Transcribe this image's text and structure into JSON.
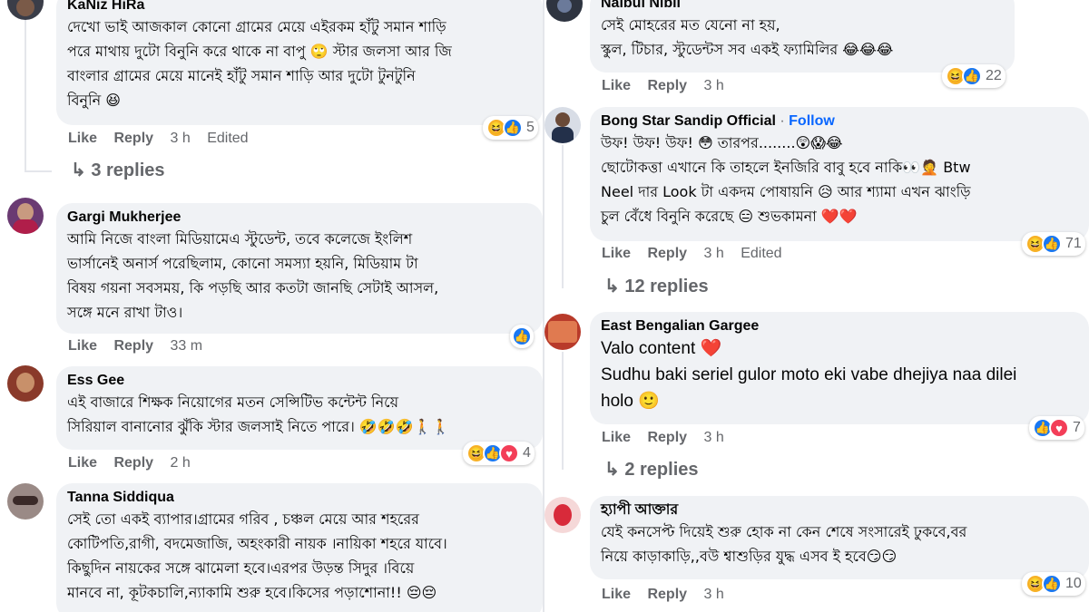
{
  "colors": {
    "accent": "#0866ff",
    "bubble": "#f0f2f5",
    "meta": "#65676b",
    "haha": "#f7b125",
    "like": "#1877f2",
    "love": "#f33e58"
  },
  "left": {
    "comments": [
      {
        "author": "KaNiz HiRa",
        "lines": [
          "দেখো ভাই আজকাল কোনো গ্রামের মেয়ে এইরকম হাঁটু সমান শাড়ি",
          "পরে মাথায় দুটো বিনুনি করে থাকে না বাপু 🙄 স্টার জলসা আর জি",
          "বাংলার গ্রামের মেয়ে মানেই হাঁটু সমান শাড়ি আর দুটো টুনটুনি",
          "বিনুনি 😆"
        ],
        "like": "Like",
        "reply": "Reply",
        "time": "3 h",
        "edited": "Edited",
        "reaction_count": "5",
        "replies": "3 replies"
      },
      {
        "author": "Gargi Mukherjee",
        "lines": [
          "আমি নিজে বাংলা মিডিয়ামেএ স্টুডেন্ট, তবে কলেজে ইংলিশ",
          "ভার্সানেই অনার্স পরেছিলাম, কোনো সমস্যা হয়নি, মিডিয়াম টা",
          "বিষয় গয়না সবসময়, কি পড়ছি আর কতটা জানছি সেটাই আসল,",
          "সঙ্গে মনে রাখা টাও।"
        ],
        "like": "Like",
        "reply": "Reply",
        "time": "33 m"
      },
      {
        "author": "Ess Gee",
        "lines": [
          "এই বাজারে শিক্ষক নিয়োগের মতন সেন্সিটিভ কন্টেন্ট নিয়ে",
          "সিরিয়াল বানানোর ঝুঁকি স্টার জলসাই নিতে পারে। 🤣🤣🤣🚶🚶"
        ],
        "like": "Like",
        "reply": "Reply",
        "time": "2 h",
        "reaction_count": "4"
      },
      {
        "author": "Tanna Siddiqua",
        "lines": [
          "সেই তো একই ব্যাপার।গ্রামের গরিব , চঞ্চল মেয়ে আর শহরের",
          "কোটিপতি,রাগী, বদমেজাজি, অহংকারী নায়ক ।নায়িকা শহরে যাবে।",
          "কিছুদিন নায়কের সঙ্গে ঝামেলা হবে।এরপর উড়ন্ত সিদুর ।বিয়ে",
          "মানবে না, কূটকচালি,ন্যাকামি শুরু হবে।কিসের পড়াশোনা!! 😔😔"
        ]
      }
    ]
  },
  "right": {
    "comments": [
      {
        "author": "Naibul Nibil",
        "lines": [
          "সেই মোহরের মত যেনো না হয়,",
          "স্কুল, টিচার, স্টুডেন্টস সব একই ফ্যামিলির 😂😂😂"
        ],
        "like": "Like",
        "reply": "Reply",
        "time": "3 h",
        "reaction_count": "22"
      },
      {
        "author": "Bong Star Sandip Official",
        "follow": "Follow",
        "lines": [
          "উফ! উফ! উফ! 😳 তারপর........😲😱😂",
          "ছোটোকত্তা এখানে কি তাহলে ইনজিরি বাবু হবে নাকি👀🤦 Btw",
          "Neel দার Look টা একদম পোষায়নি 😥 আর শ্যামা এখন ঝাংড়ি",
          "চুল বেঁধে বিনুনি করেছে 😑 শুভকামনা ❤️❤️"
        ],
        "like": "Like",
        "reply": "Reply",
        "time": "3 h",
        "edited": "Edited",
        "reaction_count": "71",
        "replies": "12 replies"
      },
      {
        "author": "East Bengalian Gargee",
        "lines": [
          "Valo content ❤️",
          "Sudhu baki seriel gulor moto eki vabe dhejiya naa dilei",
          "holo 🙂"
        ],
        "like": "Like",
        "reply": "Reply",
        "time": "3 h",
        "reaction_count": "7",
        "replies": "2 replies"
      },
      {
        "author": "হ্যাপী আক্তার",
        "lines": [
          "যেই কনসেপ্ট দিয়েই শুরু হোক না কেন শেষে সংসারেই ঢুকবে,বর",
          "নিয়ে কাড়াকাড়ি,,বউ শ্বাশুড়ির যুদ্ধ এসব ই হবে😏😏"
        ],
        "like": "Like",
        "reply": "Reply",
        "time": "3 h",
        "reaction_count": "10"
      }
    ]
  }
}
